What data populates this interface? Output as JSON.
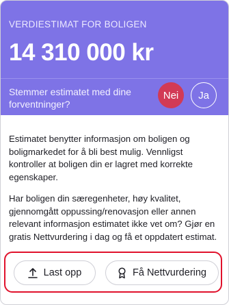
{
  "estimate": {
    "label": "VERDIESTIMAT FOR BOLIGEN",
    "price": "14 310 000 kr",
    "question": "Stemmer estimatet med dine forventninger?",
    "no_label": "Nei",
    "yes_label": "Ja"
  },
  "info": {
    "paragraph1": "Estimatet benytter informasjon om boligen og boligmarkedet for å bli best mulig. Vennligst kontroller at boligen din er lagret med korrekte egenskaper.",
    "paragraph2": "Har boligen din særegenheter, høy kvalitet, gjennomgått oppussing/renovasjon eller annen relevant informasjon estimatet ikke vet om? Gjør en gratis Nettvurdering i dag og få et oppdatert estimat."
  },
  "actions": {
    "upload_label": "Last opp",
    "upload_icon": "upload-icon",
    "valuation_label": "Få Nettvurdering",
    "valuation_icon": "award-icon"
  },
  "colors": {
    "header_bg": "#7e73e6",
    "no_button": "#d23a55",
    "highlight_border": "#e0112b"
  }
}
